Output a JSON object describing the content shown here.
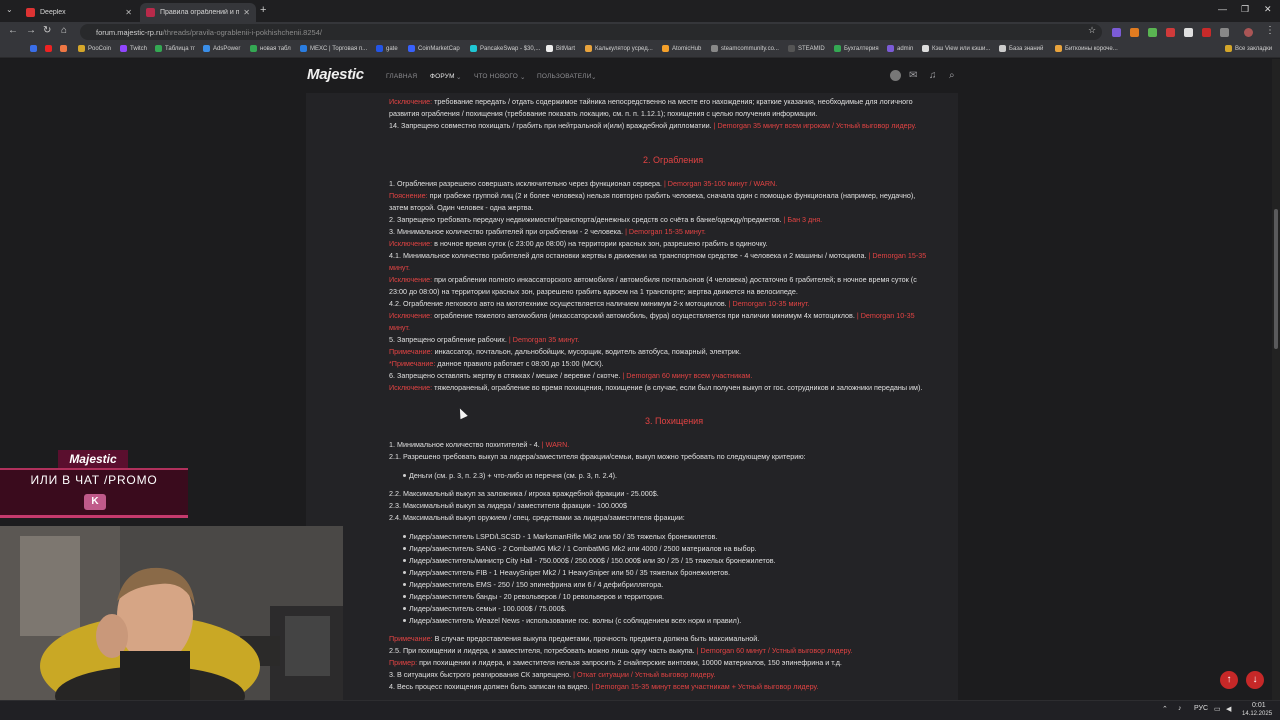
{
  "tabs": [
    {
      "label": "Deeplex",
      "active": false
    },
    {
      "label": "Правила ограблений и похи...",
      "active": true
    }
  ],
  "address": {
    "host": "forum.majestic-rp.ru",
    "path": "/threads/pravila-ograblenii-i-pokhishchenii.8254/"
  },
  "bookmarks": [
    "PooCoin",
    "Twitch",
    "Таблица тг",
    "AdsPower",
    "новая табл",
    "MEXC | Торговая п...",
    "gate",
    "CoinMarketCap",
    "PancakeSwap - $30,...",
    "BitMart",
    "Калькулятор усред...",
    "AtomicHub",
    "steamcommunity.co...",
    "STEAMID",
    "Бухгалтерия",
    "admin",
    "Кэш View или кэши...",
    "База знаний",
    "Биткоины короче...",
    "Все закладки"
  ],
  "site": {
    "logo": "Majestic",
    "nav": [
      "ГЛАВНАЯ",
      "ФОРУМ",
      "ЧТО НОВОГО",
      "ПОЛЬЗОВАТЕЛИ"
    ]
  },
  "lines": [
    {
      "t": "",
      "r": "Исключение:",
      "x": " требование передать / отдать содержимое тайника непосредственно на месте его нахождения; краткие указания, необходимые для логичного"
    },
    {
      "t": "развития ограбления / похищения (требование показать локацию, см. п. п. 1.12.1); похищения с целью получения информации."
    },
    {
      "t": "14. Запрещено совместно похищать / грабить при нейтральной и(или) враждебной дипломатии. ",
      "r": "| Demorgan 35 минут всем игрокам / Устный выговор лидеру."
    },
    {
      "t": "1. Ограбления разрешено совершать исключительно через функционал сервера. ",
      "r": "| Demorgan 35-100 минут / WARN."
    },
    {
      "t": "",
      "r": "Пояснение:",
      "x": " при грабеже группой лиц (2 и более человека) нельзя повторно грабить человека, сначала один с помощью функционала (например, неудачно),"
    },
    {
      "t": "затем второй. Один человек - одна жертва."
    },
    {
      "t": "2. Запрещено требовать передачу недвижимости/транспорта/денежных средств со счёта в банке/одежду/предметов. ",
      "r": "| Бан 3 дня."
    },
    {
      "t": "3. Минимальное количество грабителей при ограблении - 2 человека. ",
      "r": "| Demorgan 15-35 минут."
    },
    {
      "t": "",
      "r": "Исключение:",
      "x": " в ночное время суток (с 23:00 до 08:00) на территории красных зон, разрешено грабить в одиночку."
    },
    {
      "t": "4.1. Минимальное количество грабителей для остановки жертвы в движении на транспортном средстве - 4 человека и 2 машины / мотоцикла. ",
      "r": "| Demorgan 15-35"
    },
    {
      "t": "",
      "r": "минут."
    },
    {
      "t": "",
      "r": "Исключение:",
      "x": " при ограблении полного инкассаторского автомобиля / автомобиля почтальонов (4 человека) достаточно 6 грабителей; в ночное время суток (с"
    },
    {
      "t": "23:00 до 08:00) на территории красных зон, разрешено грабить вдвоем на 1 транспорте; жертва движется на велосипеде."
    },
    {
      "t": "4.2. Ограбление легкового авто на мототехнике осуществляется наличием минимум 2-х мотоциклов. ",
      "r": "| Demorgan 10-35 минут."
    },
    {
      "t": "",
      "r": "Исключение:",
      "x": " ограбление тяжелого автомобиля (инкассаторский автомобиль, фура) осуществляется при наличии минимум 4х мотоциклов. ",
      "r2": "| Demorgan 10-35"
    },
    {
      "t": "",
      "r": "минут."
    },
    {
      "t": "5. Запрещено ограбление рабочих. ",
      "r": "| Demorgan 35 минут."
    },
    {
      "t": "",
      "r": "Примечание:",
      "x": " инкассатор, почтальон, дальнобойщик, мусорщик, водитель автобуса, пожарный, электрик."
    },
    {
      "t": "",
      "r": "*Примечание:",
      "x": " данное правило работает с 08:00 до 15:00 (МСК)."
    },
    {
      "t": "6. Запрещено оставлять жертву в стяжках / мешке / веревке / скотче. ",
      "r": "| Demorgan 60 минут всем участникам."
    },
    {
      "t": "",
      "r": "Исключение:",
      "x": " тяжелораненый, ограбление во время похищения, похищение (в случае, если был получен выкуп от гос. сотрудников и заложники переданы им)."
    },
    {
      "t": "1. Минимальное количество похитителей - 4. ",
      "r": "| WARN."
    },
    {
      "t": "2.1. Разрешено требовать выкуп за лидера/заместителя фракции/семьи, выкуп можно требовать по следующему критерию:"
    },
    {
      "t": "Деньги (см. р. 3, п. 2.3) + что-либо из перечня (см. р. 3, п. 2.4)."
    },
    {
      "t": "2.2. Максимальный выкуп за заложника / игрока враждебной фракции - 25.000$."
    },
    {
      "t": "2.3. Максимальный выкуп за лидера / заместителя фракции - 100.000$"
    },
    {
      "t": "2.4. Максимальный выкуп оружием / спец. средствами за лидера/заместителя фракции:"
    },
    {
      "t": "Лидер/заместитель LSPD/LSCSD - 1 MarksmanRifle Mk2 или 50 / 35 тяжелых бронежилетов."
    },
    {
      "t": "Лидер/заместитель SANG - 2 CombatMG Mk2 / 1 CombatMG Mk2 или 4000 / 2500 материалов на выбор."
    },
    {
      "t": "Лидер/заместитель/министр City Hall - 750.000$ / 250.000$ / 150.000$ или 30 / 25 / 15 тяжелых бронежилетов."
    },
    {
      "t": "Лидер/заместитель FIB - 1 HeavySniper Mk2 / 1 HeavySniper или 50 / 35 тяжелых бронежилетов."
    },
    {
      "t": "Лидер/заместитель EMS - 250 / 150 эпинефрина или 6 / 4 дефибриллятора."
    },
    {
      "t": "Лидер/заместитель банды - 20 револьверов / 10 револьверов и территория."
    },
    {
      "t": "Лидер/заместитель семьи - 100.000$ / 75.000$."
    },
    {
      "t": "Лидер/заместитель Weazel News - использование гос. волны (с соблюдением всех норм и правил)."
    },
    {
      "t": "",
      "r": "Примечание:",
      "x": " В случае предоставления выкупа предметами, прочность предмета должна быть максимальной."
    },
    {
      "t": "2.5. При похищении и лидера, и заместителя, потребовать можно лишь одну часть выкупа. ",
      "r": "| Demorgan 60 минут / Устный выговор лидеру."
    },
    {
      "t": "",
      "r": "Пример:",
      "x": " при похищении и лидера, и заместителя нельзя запросить 2 снайперские винтовки, 10000 материалов, 150 эпинефрина и т.д."
    },
    {
      "t": "3. В ситуациях быстрого реагирования СК запрещено. ",
      "r": "| Откат ситуации / Устный выговор лидеру."
    },
    {
      "t": "4. Весь процесс похищения должен быть записан на видео. ",
      "r": "| Demorgan 15-35 минут всем участникам + Устный выговор лидеру."
    }
  ],
  "headings": [
    "2. Ограбления",
    "3. Похищения"
  ],
  "promo": {
    "brand": "Majestic",
    "text": "ИЛИ В ЧАТ /PROMO"
  },
  "taskbar": {
    "lang": "РУС",
    "time": "0:01",
    "date": "14.12.2025"
  }
}
